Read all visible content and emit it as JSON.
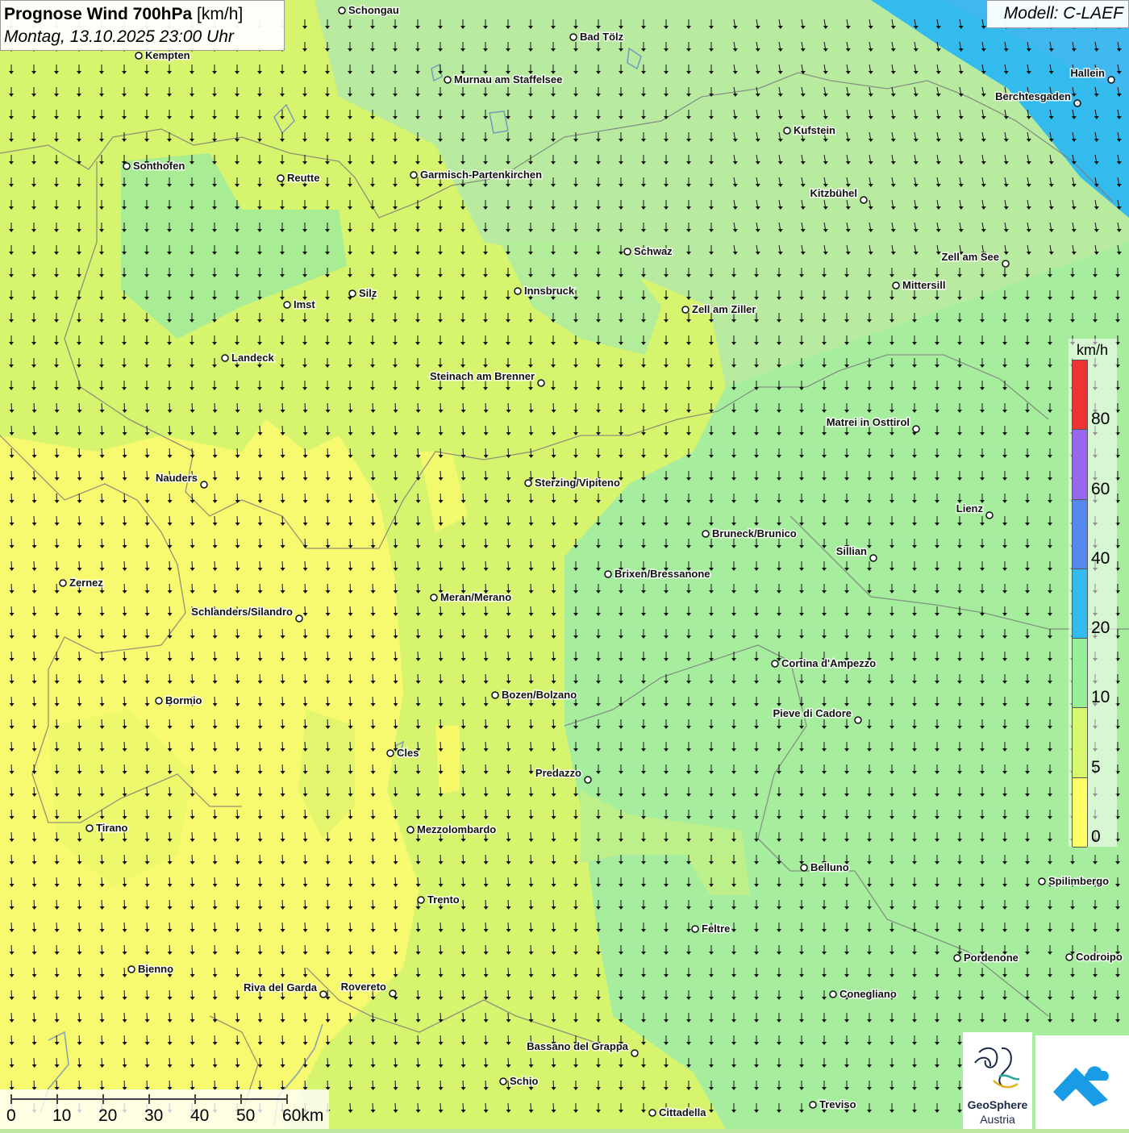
{
  "header": {
    "title_bold": "Prognose Wind 700hPa",
    "title_unit": " [km/h]",
    "subtitle": "Montag, 13.10.2025 23:00 Uhr",
    "model": "Modell: C-LAEF"
  },
  "legend": {
    "unit": "km/h",
    "bands": [
      {
        "from": 0,
        "to": 5,
        "color": "#ffff66"
      },
      {
        "from": 5,
        "to": 10,
        "color": "#d8f870"
      },
      {
        "from": 10,
        "to": 20,
        "color": "#99ee99"
      },
      {
        "from": 20,
        "to": 40,
        "color": "#33bbee"
      },
      {
        "from": 40,
        "to": 60,
        "color": "#5588ee"
      },
      {
        "from": 60,
        "to": 80,
        "color": "#9966ee"
      },
      {
        "from": 80,
        "to": 100,
        "color": "#ee3333"
      }
    ],
    "ticks": [
      "0",
      "5",
      "10",
      "20",
      "40",
      "60",
      "80"
    ]
  },
  "scale_bar": {
    "labels": [
      "0",
      "10",
      "20",
      "30",
      "40",
      "50",
      "60km"
    ]
  },
  "logos": {
    "geosphere_line1": "GeoSphere",
    "geosphere_line2": "Austria"
  },
  "cities": [
    {
      "name": "Schongau"
    },
    {
      "name": "Bad Tölz"
    },
    {
      "name": "Kempten"
    },
    {
      "name": "Murnau am Staffelsee"
    },
    {
      "name": "Hallein"
    },
    {
      "name": "Berchtesgaden"
    },
    {
      "name": "Kufstein"
    },
    {
      "name": "Sonthofen"
    },
    {
      "name": "Reutte"
    },
    {
      "name": "Garmisch-Partenkirchen"
    },
    {
      "name": "Kitzbühel"
    },
    {
      "name": "Schwaz"
    },
    {
      "name": "Zell am See"
    },
    {
      "name": "Innsbruck"
    },
    {
      "name": "Mittersill"
    },
    {
      "name": "Silz"
    },
    {
      "name": "Imst"
    },
    {
      "name": "Zell am Ziller"
    },
    {
      "name": "Landeck"
    },
    {
      "name": "Steinach am Brenner"
    },
    {
      "name": "Matrei in Osttirol"
    },
    {
      "name": "Nauders"
    },
    {
      "name": "Sterzing/Vipiteno"
    },
    {
      "name": "Lienz"
    },
    {
      "name": "Bruneck/Brunico"
    },
    {
      "name": "Sillian"
    },
    {
      "name": "Brixen/Bressanone"
    },
    {
      "name": "Zernez"
    },
    {
      "name": "Meran/Merano"
    },
    {
      "name": "Schlanders/Silandro"
    },
    {
      "name": "Cortina d'Ampezzo"
    },
    {
      "name": "Bozen/Bolzano"
    },
    {
      "name": "Bormio"
    },
    {
      "name": "Pieve di Cadore"
    },
    {
      "name": "Cles"
    },
    {
      "name": "Predazzo"
    },
    {
      "name": "Tirano"
    },
    {
      "name": "Mezzolombardo"
    },
    {
      "name": "Belluno"
    },
    {
      "name": "Spilimbergo"
    },
    {
      "name": "Trento"
    },
    {
      "name": "Feltre"
    },
    {
      "name": "Pordenone"
    },
    {
      "name": "Codroipo"
    },
    {
      "name": "Bienno"
    },
    {
      "name": "Riva del Garda"
    },
    {
      "name": "Rovereto"
    },
    {
      "name": "Conegliano"
    },
    {
      "name": "Bassano del Grappa"
    },
    {
      "name": "Schio"
    },
    {
      "name": "Treviso"
    },
    {
      "name": "Cittadella"
    }
  ]
}
